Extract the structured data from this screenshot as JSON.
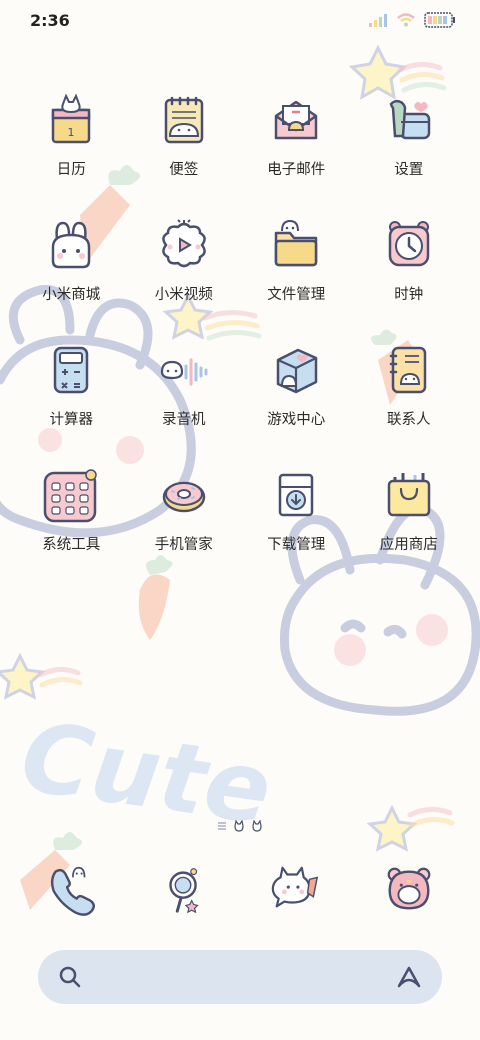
{
  "status_bar": {
    "time": "2:36"
  },
  "apps": [
    {
      "id": "calendar",
      "label": "日历",
      "icon": "calendar-icon"
    },
    {
      "id": "notes",
      "label": "便签",
      "icon": "notes-icon"
    },
    {
      "id": "email",
      "label": "电子邮件",
      "icon": "mail-icon"
    },
    {
      "id": "settings",
      "label": "设置",
      "icon": "settings-icon"
    },
    {
      "id": "mi-store",
      "label": "小米商城",
      "icon": "bunny-store-icon"
    },
    {
      "id": "mi-video",
      "label": "小米视频",
      "icon": "video-play-icon"
    },
    {
      "id": "file-manager",
      "label": "文件管理",
      "icon": "folder-icon"
    },
    {
      "id": "clock",
      "label": "时钟",
      "icon": "clock-icon"
    },
    {
      "id": "calculator",
      "label": "计算器",
      "icon": "calculator-icon"
    },
    {
      "id": "recorder",
      "label": "录音机",
      "icon": "sound-wave-icon"
    },
    {
      "id": "game-center",
      "label": "游戏中心",
      "icon": "game-cube-icon"
    },
    {
      "id": "contacts",
      "label": "联系人",
      "icon": "contacts-book-icon"
    },
    {
      "id": "system-tools",
      "label": "系统工具",
      "icon": "tools-folder-icon"
    },
    {
      "id": "security",
      "label": "手机管家",
      "icon": "donut-icon"
    },
    {
      "id": "downloads",
      "label": "下载管理",
      "icon": "download-box-icon"
    },
    {
      "id": "app-store",
      "label": "应用商店",
      "icon": "shopping-bag-icon"
    }
  ],
  "dock": [
    {
      "id": "phone",
      "icon": "phone-icon"
    },
    {
      "id": "browser",
      "icon": "magnifier-icon"
    },
    {
      "id": "messages",
      "icon": "chat-bubble-icon"
    },
    {
      "id": "camera",
      "icon": "bear-camera-icon"
    }
  ],
  "search_bar": {
    "placeholder": ""
  },
  "wallpaper": {
    "text": "Cute"
  },
  "colors": {
    "background": "#fdfcf8",
    "outline": "#4a4f6e",
    "pink": "#f3b8c0",
    "blue_outline": "#c8cde0",
    "search_bg": "#dce4ef",
    "yellow": "#f7d98a"
  }
}
